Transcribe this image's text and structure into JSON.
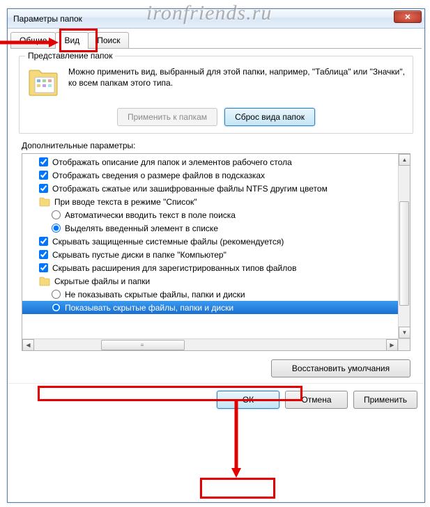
{
  "watermark": "ironfriends.ru",
  "window": {
    "title": "Параметры папок"
  },
  "tabs": {
    "general": "Общие",
    "view": "Вид",
    "search": "Поиск"
  },
  "folder_views": {
    "legend": "Представление папок",
    "description": "Можно применить вид, выбранный для этой папки, например, \"Таблица\" или \"Значки\", ко всем папкам этого типа.",
    "apply_btn": "Применить к папкам",
    "reset_btn": "Сброс вида папок"
  },
  "advanced": {
    "label": "Дополнительные параметры:",
    "items": [
      {
        "type": "check",
        "checked": true,
        "indent": 1,
        "text": "Отображать описание для папок и элементов рабочего стола"
      },
      {
        "type": "check",
        "checked": true,
        "indent": 1,
        "text": "Отображать сведения о размере файлов в подсказках"
      },
      {
        "type": "check",
        "checked": true,
        "indent": 1,
        "text": "Отображать сжатые или зашифрованные файлы NTFS другим цветом"
      },
      {
        "type": "folder",
        "indent": 1,
        "text": "При вводе текста в режиме \"Список\""
      },
      {
        "type": "radio",
        "checked": false,
        "indent": 2,
        "text": "Автоматически вводить текст в поле поиска"
      },
      {
        "type": "radio",
        "checked": true,
        "indent": 2,
        "text": "Выделять введенный элемент в списке"
      },
      {
        "type": "check",
        "checked": true,
        "indent": 1,
        "text": "Скрывать защищенные системные файлы (рекомендуется)"
      },
      {
        "type": "check",
        "checked": true,
        "indent": 1,
        "text": "Скрывать пустые диски в папке \"Компьютер\""
      },
      {
        "type": "check",
        "checked": true,
        "indent": 1,
        "text": "Скрывать расширения для зарегистрированных типов файлов"
      },
      {
        "type": "folder",
        "indent": 1,
        "text": "Скрытые файлы и папки"
      },
      {
        "type": "radio",
        "checked": false,
        "indent": 2,
        "text": "Не показывать скрытые файлы, папки и диски"
      },
      {
        "type": "radio",
        "checked": true,
        "indent": 2,
        "selected": true,
        "text": "Показывать скрытые файлы, папки и диски"
      }
    ],
    "restore_btn": "Восстановить умолчания"
  },
  "dialog": {
    "ok": "ОК",
    "cancel": "Отмена",
    "apply": "Применить"
  }
}
